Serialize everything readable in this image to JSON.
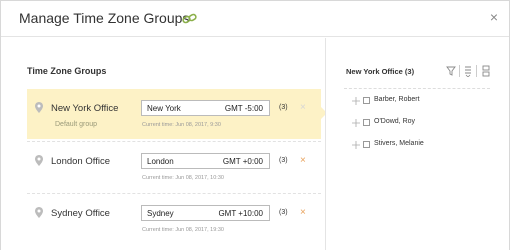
{
  "dialog": {
    "title": "Manage Time Zone Groups",
    "close_label": "×"
  },
  "groups_panel": {
    "title": "Time Zone Groups",
    "groups": [
      {
        "name": "New York Office",
        "sub": "Default group",
        "city": "New York",
        "offset": "GMT -5:00",
        "count": "(3)",
        "time": "Current time: Jun 08, 2017, 9:30",
        "active": true
      },
      {
        "name": "London Office",
        "sub": "",
        "city": "London",
        "offset": "GMT +0:00",
        "count": "(3)",
        "time": "Current time: Jun 08, 2017, 10:30",
        "active": false
      },
      {
        "name": "Sydney Office",
        "sub": "",
        "city": "Sydney",
        "offset": "GMT +10:00",
        "count": "(3)",
        "time": "Current time: Jun 08, 2017, 19:30",
        "active": false
      }
    ],
    "remove_label": "×"
  },
  "members_panel": {
    "title": "New York Office (3)",
    "members": [
      "Barber, Robert",
      "O'Dowd, Roy",
      "Stivers, Melanie"
    ]
  },
  "colors": {
    "active_row": "#fdf2c6",
    "remove_active": "#d6d6d6",
    "remove": "#e8a15a",
    "link_icon": "#8bb04a"
  }
}
